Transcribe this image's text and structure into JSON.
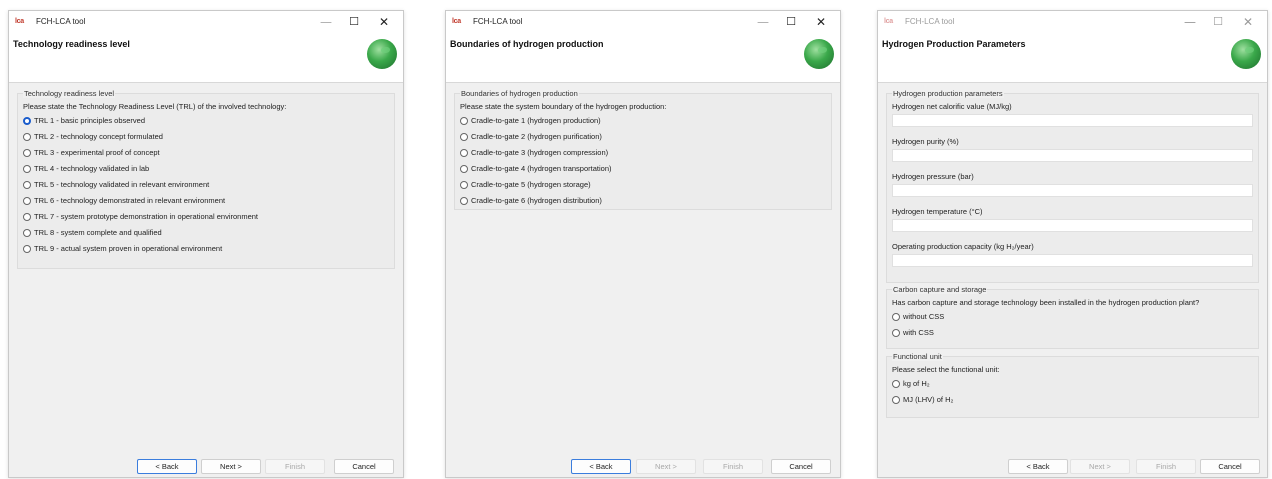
{
  "app": {
    "icon_text": "lca",
    "title": "FCH-LCA tool",
    "minimize_symbol": "—",
    "maximize_symbol": "☐",
    "close_symbol": "✕"
  },
  "footer_labels": {
    "back": "< Back",
    "next": "Next >",
    "finish": "Finish",
    "cancel": "Cancel"
  },
  "trl_window": {
    "header_title": "Technology readiness level",
    "group_title": "Technology readiness level",
    "prompt": "Please state the Technology Readiness Level (TRL) of the involved technology:",
    "options": [
      "TRL 1 - basic principles observed",
      "TRL 2 - technology concept formulated",
      "TRL 3 - experimental proof of concept",
      "TRL 4 - technology validated in lab",
      "TRL 5 - technology validated in relevant environment",
      "TRL 6 - technology demonstrated in relevant environment",
      "TRL 7 - system prototype demonstration in operational environment",
      "TRL 8 - system complete and qualified",
      "TRL 9 - actual system proven in operational environment"
    ],
    "selected": "TRL 1 - basic principles observed"
  },
  "boundary_window": {
    "header_title": "Boundaries of hydrogen production",
    "group_title": "Boundaries of hydrogen production",
    "prompt": "Please state the system boundary of the hydrogen production:",
    "options": [
      "Cradle-to-gate 1 (hydrogen production)",
      "Cradle-to-gate 2 (hydrogen purification)",
      "Cradle-to-gate 3 (hydrogen compression)",
      "Cradle-to-gate 4 (hydrogen transportation)",
      "Cradle-to-gate 5 (hydrogen storage)",
      "Cradle-to-gate 6 (hydrogen distribution)"
    ]
  },
  "params_window": {
    "header_title": "Hydrogen Production Parameters",
    "params_group": {
      "title": "Hydrogen production parameters",
      "fields": [
        {
          "label": "Hydrogen net calorific value (MJ/kg)",
          "value": ""
        },
        {
          "label": "Hydrogen purity (%)",
          "value": ""
        },
        {
          "label": "Hydrogen pressure (bar)",
          "value": ""
        },
        {
          "label": "Hydrogen temperature (°C)",
          "value": ""
        },
        {
          "label": "Operating production capacity (kg H₂/year)",
          "value": ""
        }
      ]
    },
    "ccs_group": {
      "title": "Carbon capture and storage",
      "prompt": "Has carbon capture and storage technology been installed in the hydrogen production plant?",
      "options": [
        "without CSS",
        "with CSS"
      ]
    },
    "fu_group": {
      "title": "Functional unit",
      "prompt": "Please select the functional unit:",
      "options": [
        "kg of H₂",
        "MJ (LHV) of H₂"
      ]
    }
  }
}
